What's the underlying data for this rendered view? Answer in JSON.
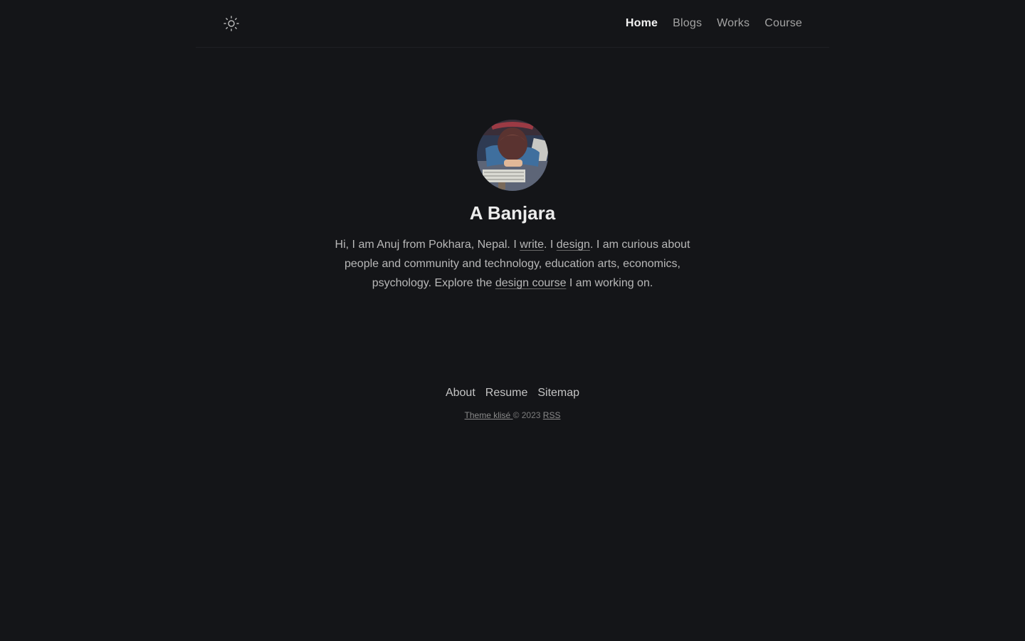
{
  "header": {
    "theme_icon": "sun-icon",
    "nav": [
      {
        "label": "Home",
        "active": true
      },
      {
        "label": "Blogs",
        "active": false
      },
      {
        "label": "Works",
        "active": false
      },
      {
        "label": "Course",
        "active": false
      }
    ]
  },
  "profile": {
    "avatar_icon": "avatar-illustration",
    "name": "A Banjara",
    "bio": {
      "t1": "Hi, I am Anuj from Pokhara, Nepal. I ",
      "link_write": "write",
      "t2": ". I ",
      "link_design": "design",
      "t3": ". I am curious about people and community and technology, education arts, economics, psychology. Explore the ",
      "link_course": "design course",
      "t4": " I am working on."
    }
  },
  "footer": {
    "links": [
      "About",
      "Resume",
      "Sitemap"
    ],
    "theme_link": "Theme klisé ",
    "copyright": " © 2023 ",
    "rss": "RSS"
  },
  "colors": {
    "background": "#141518",
    "text": "#b8b8b8",
    "heading": "#ececec"
  }
}
